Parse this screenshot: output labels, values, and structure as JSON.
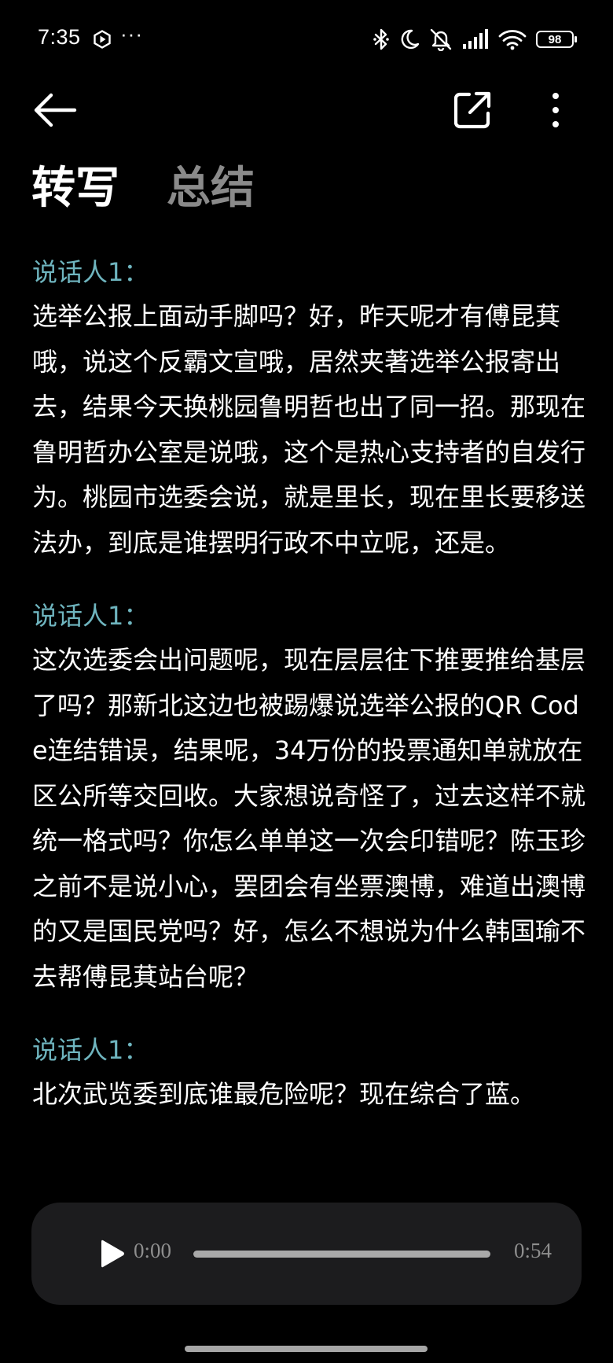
{
  "status_bar": {
    "time": "7:35",
    "dots": "···",
    "battery_level": "98",
    "icons": [
      "app-notification-icon",
      "bluetooth-icon",
      "moon-icon",
      "bell-muted-icon",
      "signal-icon",
      "wifi-icon",
      "battery-icon"
    ]
  },
  "top_bar": {
    "icons": [
      "back-arrow-icon",
      "share-icon",
      "more-vert-icon"
    ]
  },
  "tabs": [
    {
      "label": "转写",
      "active": true
    },
    {
      "label": "总结",
      "active": false
    }
  ],
  "transcript": [
    {
      "speaker": "说话人1：",
      "text": "选举公报上面动手脚吗？好，昨天呢才有傅昆萁哦，说这个反霸文宣哦，居然夹著选举公报寄出去，结果今天换桃园鲁明哲也出了同一招。那现在鲁明哲办公室是说哦，这个是热心支持者的自发行为。桃园市选委会说，就是里长，现在里长要移送法办，到底是谁摆明行政不中立呢，还是。"
    },
    {
      "speaker": "说话人1：",
      "text": "这次选委会出问题呢，现在层层往下推要推给基层了吗？那新北这边也被踢爆说选举公报的QR Code连结错误，结果呢，34万份的投票通知单就放在区公所等交回收。大家想说奇怪了，过去这样不就统一格式吗？你怎么单单这一次会印错呢？陈玉珍之前不是说小心，罢团会有坐票澳博，难道出澳博的又是国民党吗？好，怎么不想说为什么韩国瑜不去帮傅昆萁站台呢？"
    },
    {
      "speaker": "说话人1：",
      "text": "北次武览委到底谁最危险呢？现在综合了蓝。"
    }
  ],
  "player": {
    "current_time": "0:00",
    "total_time": "0:54",
    "progress": 0,
    "icon": "play-icon"
  },
  "colors": {
    "background": "#000000",
    "speaker_label": "#6fb5bf",
    "inactive_tab": "#8a8a8a",
    "player_bg": "#1c1c1e"
  }
}
